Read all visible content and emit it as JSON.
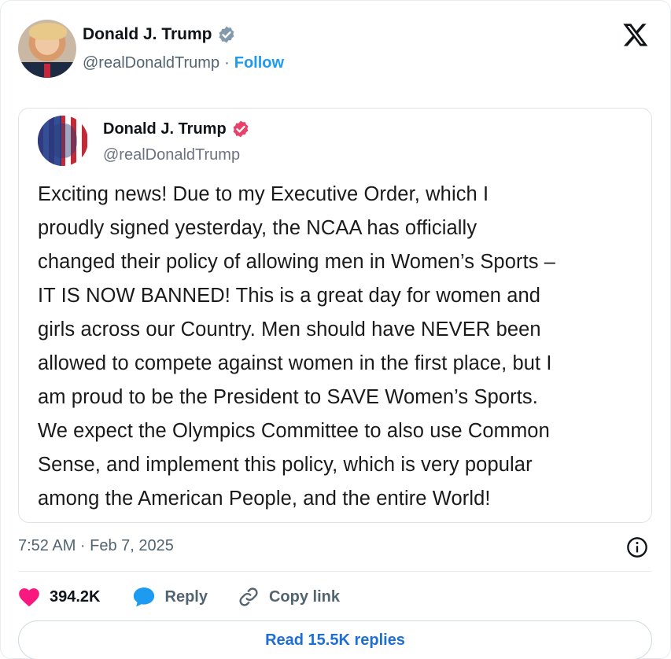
{
  "header": {
    "name": "Donald J. Trump",
    "handle": "@realDonaldTrump",
    "separator": "·",
    "follow_label": "Follow"
  },
  "quoted": {
    "name": "Donald J. Trump",
    "handle": "@realDonaldTrump",
    "text_lines": [
      "Exciting news! Due to my Executive Order, which I",
      "proudly signed yesterday, the NCAA has officially",
      "changed their policy of allowing men in Women’s Sports –",
      "IT IS NOW BANNED! This is a great day for women and",
      "girls across our Country. Men should have NEVER been",
      "allowed to compete against women in the first place, but I",
      "am proud to be the President to SAVE Women’s Sports.",
      "We expect the Olympics Committee to also use Common",
      "Sense, and implement this policy, which is very popular",
      "among the American People, and the entire World!"
    ]
  },
  "footer": {
    "timestamp": "7:52 AM · Feb 7, 2025",
    "likes": "394.2K",
    "reply_label": "Reply",
    "copy_link_label": "Copy link",
    "read_replies_label": "Read 15.5K replies"
  },
  "colors": {
    "verified_badge": "#829aab",
    "truth_badge": "#e8426a",
    "like_heart": "#f91880",
    "reply_bubble": "#1d9bf0",
    "follow_link": "#1d9bf0"
  },
  "icons": {
    "platform_logo": "x-logo-icon",
    "verified": "verified-badge-icon",
    "info": "info-icon",
    "like": "heart-icon",
    "reply": "speech-bubble-icon",
    "copy": "link-icon"
  }
}
